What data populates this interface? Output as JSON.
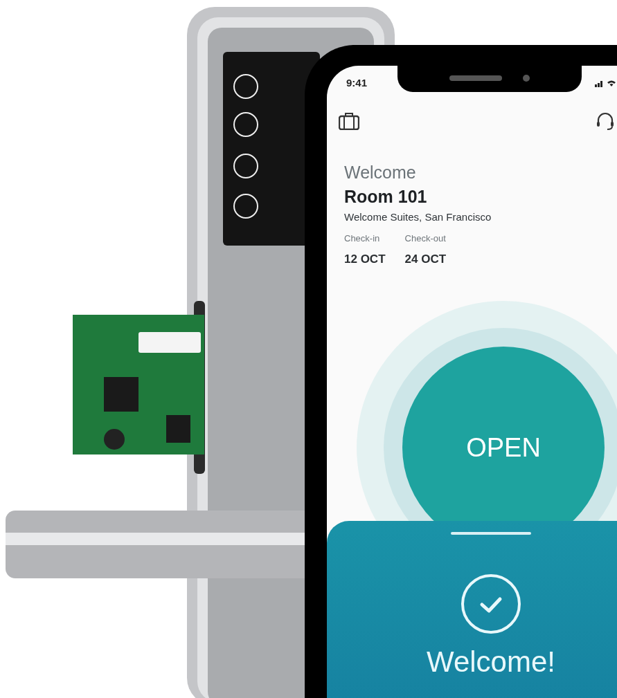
{
  "status_bar": {
    "time": "9:41"
  },
  "greeting": "Welcome",
  "room": "Room 101",
  "hotel": "Welcome Suites, San Francisco",
  "stay": [
    {
      "label": "Check-in",
      "date": "12 OCT"
    },
    {
      "label": "Check-out",
      "date": "24 OCT"
    }
  ],
  "open_button": {
    "label": "OPEN"
  },
  "sheet": {
    "message": "Welcome!"
  }
}
